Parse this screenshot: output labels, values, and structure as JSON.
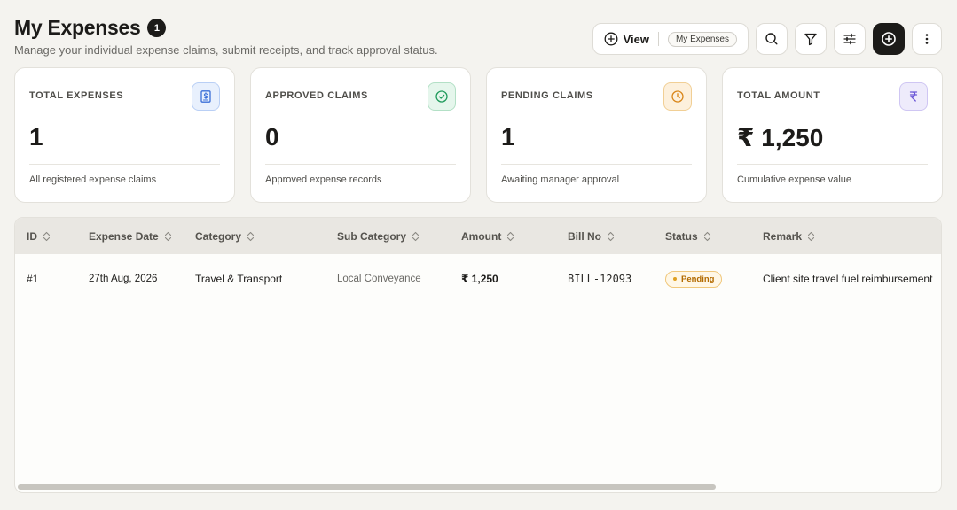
{
  "header": {
    "title": "My Expenses",
    "count": "1",
    "subtitle": "Manage your individual expense claims, submit receipts, and track approval status."
  },
  "toolbar": {
    "view_label": "View",
    "view_chip": "My Expenses",
    "icons": [
      "search-icon",
      "filter-icon",
      "sliders-icon",
      "add-circle-icon",
      "more-vertical-icon"
    ]
  },
  "cards": [
    {
      "label": "TOTAL EXPENSES",
      "value": "1",
      "desc": "All registered expense claims",
      "icon": "receipt-dollar-icon",
      "color": "#3b6fd8"
    },
    {
      "label": "APPROVED CLAIMS",
      "value": "0",
      "desc": "Approved expense records",
      "icon": "check-circle-icon",
      "color": "#1f9a5b"
    },
    {
      "label": "PENDING CLAIMS",
      "value": "1",
      "desc": "Awaiting manager approval",
      "icon": "clock-icon",
      "color": "#d9861a"
    },
    {
      "label": "TOTAL AMOUNT",
      "value": "₹ 1,250",
      "desc": "Cumulative expense value",
      "icon": "rupee-icon",
      "color": "#6a56d6"
    }
  ],
  "table": {
    "columns": [
      "ID",
      "Expense Date",
      "Category",
      "Sub Category",
      "Amount",
      "Bill No",
      "Status",
      "Remark"
    ],
    "rows": [
      {
        "id": "#1",
        "date": "27th Aug, 2026",
        "category": "Travel & Transport",
        "sub_category": "Local Conveyance",
        "amount": "₹ 1,250",
        "bill_no": "BILL-12093",
        "status": "Pending",
        "remark": "Client site travel fuel reimbursement"
      }
    ]
  },
  "colors": {
    "background": "#f4f3ef",
    "dark": "#1c1b19",
    "pending": "#b36b00"
  }
}
